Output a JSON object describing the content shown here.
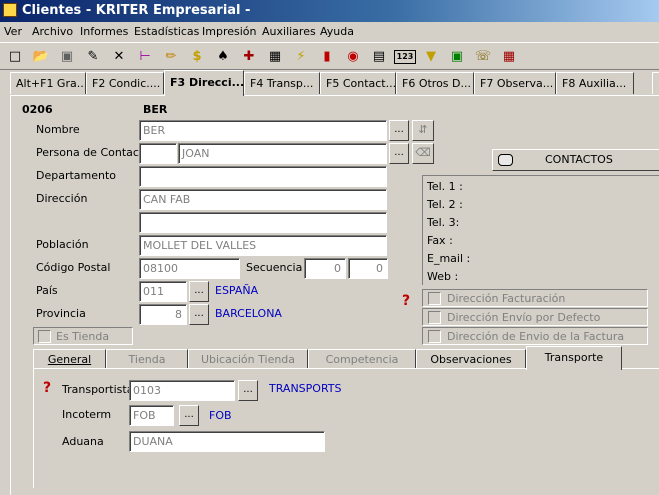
{
  "window": {
    "title": "Clientes - KRITER Empresarial -"
  },
  "menu": [
    "Ver",
    "Archivo",
    "Informes",
    "Estadísticas",
    "Impresión",
    "Auxiliares",
    "Ayuda"
  ],
  "toolbar_icons": [
    "new-icon",
    "open-icon",
    "save-icon",
    "edit-icon",
    "delete-icon",
    "tree-icon",
    "pencil-icon",
    "dollar-icon",
    "stamp-icon",
    "tools-icon",
    "table-icon",
    "lightning-icon",
    "bar-chart-icon",
    "camera-icon",
    "form-icon",
    "counter-123-icon",
    "tag-icon",
    "calculator-icon",
    "phone-icon",
    "document-icon"
  ],
  "tabs": [
    {
      "label": "Alt+F1 Gra...",
      "active": false
    },
    {
      "label": "F2 Condic....",
      "active": false
    },
    {
      "label": "F3 Direcci...",
      "active": true
    },
    {
      "label": "F4 Transp...",
      "active": false
    },
    {
      "label": "F5 Contact...",
      "active": false
    },
    {
      "label": "F6 Otros D...",
      "active": false
    },
    {
      "label": "F7 Observa...",
      "active": false
    },
    {
      "label": "F8 Auxilia...",
      "active": false
    }
  ],
  "client": {
    "code": "0206",
    "name_short": "BER"
  },
  "form": {
    "nombre_label": "Nombre",
    "nombre": "BER",
    "contacto_label": "Persona de Contacto",
    "contacto_prefix": "",
    "contacto": "JOAN",
    "departamento_label": "Departamento",
    "departamento": "",
    "direccion_label": "Dirección",
    "direccion1": "CAN FAB",
    "direccion2": "",
    "poblacion_label": "Población",
    "poblacion": "MOLLET DEL VALLES",
    "cp_label": "Código Postal",
    "cp": "08100",
    "secuencia_label": "Secuencia",
    "secuencia1": "0",
    "secuencia2": "0",
    "pais_label": "País",
    "pais_code": "011",
    "pais_name": "ESPAÑA",
    "provincia_label": "Provincia",
    "provincia_code": "8",
    "provincia_name": "BARCELONA",
    "es_tienda_label": "Es Tienda",
    "ellipsis": "..."
  },
  "contacts": {
    "button_label": "CONTACTOS",
    "tel1": "Tel. 1 :",
    "tel2": "Tel. 2 :",
    "tel3": "Tel. 3:",
    "fax": "Fax :",
    "email": "E_mail :",
    "web": "Web :"
  },
  "checks": {
    "facturacion": "Dirección Facturación",
    "envio_defecto": "Dirección Envío por Defecto",
    "envio_factura": "Dirección de Envio de la Factura"
  },
  "subtabs": [
    {
      "label": "General",
      "enabled": true,
      "active": false
    },
    {
      "label": "Tienda",
      "enabled": false,
      "active": false
    },
    {
      "label": "Ubicación Tienda",
      "enabled": false,
      "active": false
    },
    {
      "label": "Competencia",
      "enabled": false,
      "active": false
    },
    {
      "label": "Observaciones",
      "enabled": true,
      "active": false
    },
    {
      "label": "Transporte",
      "enabled": true,
      "active": true
    }
  ],
  "transporte": {
    "transportista_label": "Transportista",
    "transportista_code": "0103",
    "transportista_name": "TRANSPORTS",
    "incoterm_label": "Incoterm",
    "incoterm_code": "FOB",
    "incoterm_name": "FOB",
    "aduana_label": "Aduana",
    "aduana": "DUANA"
  },
  "colors": {
    "titlebar": "#0a246a",
    "link_blue": "#0000c0",
    "face": "#d4d0c8",
    "help_red": "#c00000"
  }
}
